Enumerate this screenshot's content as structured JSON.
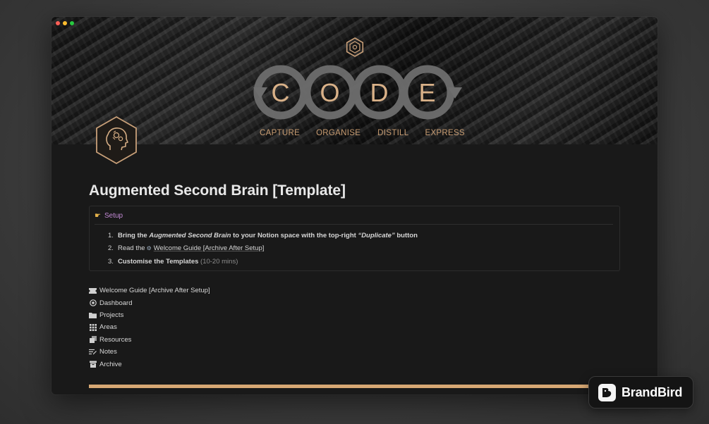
{
  "window": {
    "traffic_lights": {
      "close": "#ff5f57",
      "minimize": "#febc2e",
      "maximize": "#28c840"
    }
  },
  "cover": {
    "letters": [
      "C",
      "O",
      "D",
      "E"
    ],
    "steps": [
      "CAPTURE",
      "ORGANISE",
      "DISTILL",
      "EXPRESS"
    ],
    "accent_color": "#d9b188"
  },
  "page": {
    "title": "Augmented Second Brain [Template]",
    "icon": "head-gears-icon"
  },
  "setup": {
    "icon": "pointing-hand-icon",
    "label": "Setup",
    "items": [
      {
        "num": "1.",
        "pre": "Bring the",
        "em": "Augmented Second Brain",
        "mid": "to your Notion space with the top-right",
        "quote": "“Duplicate”",
        "post": "button"
      },
      {
        "num": "2.",
        "pre": "Read the",
        "icon": "tools-icon",
        "link": "Welcome Guide [Archive After Setup]"
      },
      {
        "num": "3.",
        "bold": "Customise the Templates",
        "muted": "(10-20 mins)"
      }
    ]
  },
  "pages": [
    {
      "icon": "ticket-icon",
      "label": "Welcome Guide [Archive After Setup]"
    },
    {
      "icon": "target-icon",
      "label": "Dashboard"
    },
    {
      "icon": "folder-icon",
      "label": "Projects"
    },
    {
      "icon": "grid-icon",
      "label": "Areas"
    },
    {
      "icon": "stack-icon",
      "label": "Resources"
    },
    {
      "icon": "notes-icon",
      "label": "Notes"
    },
    {
      "icon": "archive-box-icon",
      "label": "Archive"
    }
  ],
  "badge": {
    "label": "BrandBird"
  }
}
